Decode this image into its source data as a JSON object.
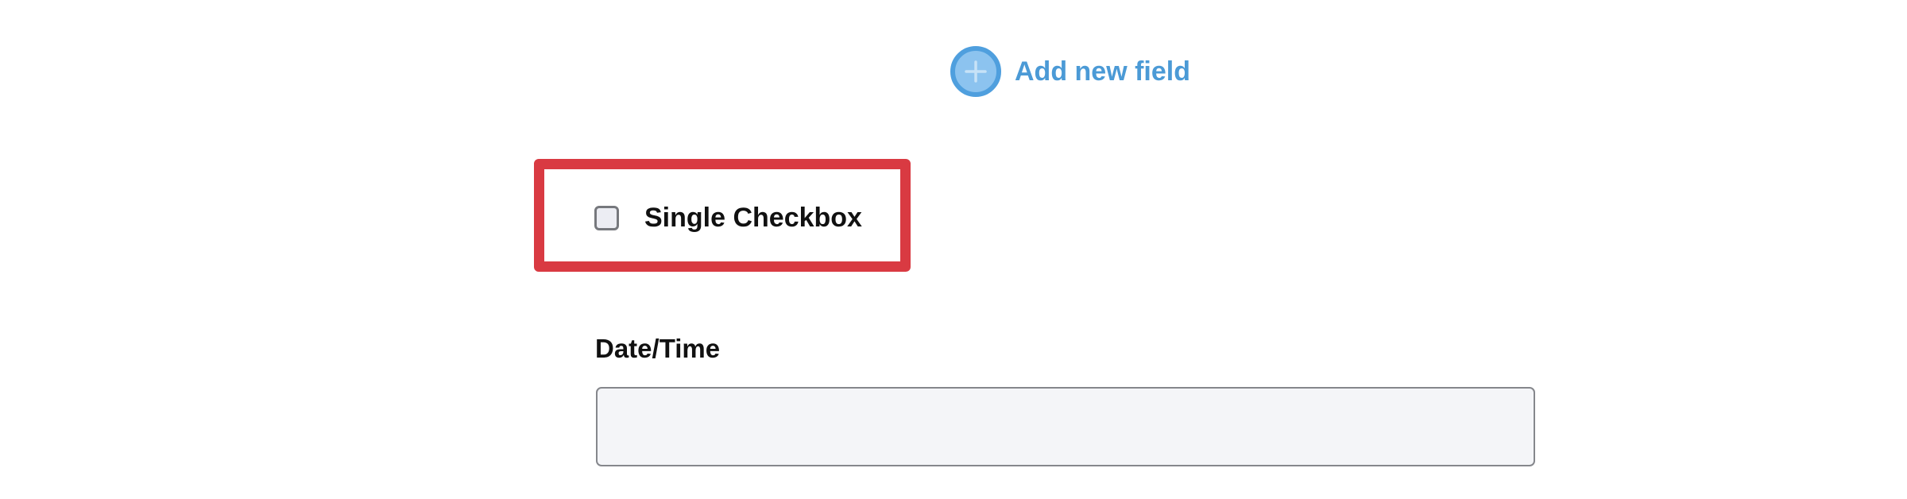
{
  "add_field": {
    "label": "Add new field",
    "icon": "plus-circle-icon",
    "color": "#4b9ad6"
  },
  "single_checkbox": {
    "label": "Single Checkbox",
    "checked": false,
    "highlight_color": "#d93a42"
  },
  "date_time": {
    "label": "Date/Time",
    "value": "",
    "placeholder": ""
  }
}
